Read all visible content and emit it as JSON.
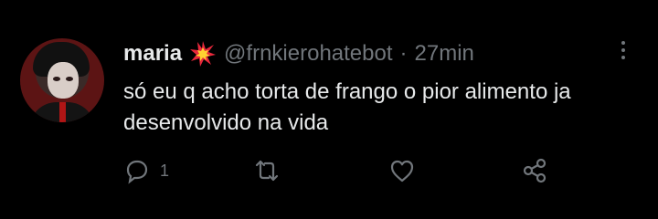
{
  "tweet": {
    "author": {
      "name": "maria",
      "handle": "@frnkierohatebot",
      "avatar_icon": "profile-photo"
    },
    "separator": "·",
    "time": "27min",
    "emoji_icon": "collision-emoji",
    "text": "só eu q acho torta de frango o pior alimento ja desenvolvido na vida",
    "actions": {
      "reply": {
        "icon": "reply-bubble-icon",
        "count": "1"
      },
      "retweet": {
        "icon": "retweet-icon",
        "count": ""
      },
      "like": {
        "icon": "heart-icon",
        "count": ""
      },
      "share": {
        "icon": "share-icon",
        "count": ""
      }
    }
  },
  "colors": {
    "background": "#000000",
    "text": "#e7e9ea",
    "muted": "#71767b",
    "emoji_red": "#e8283c",
    "emoji_yellow": "#ffd230"
  }
}
